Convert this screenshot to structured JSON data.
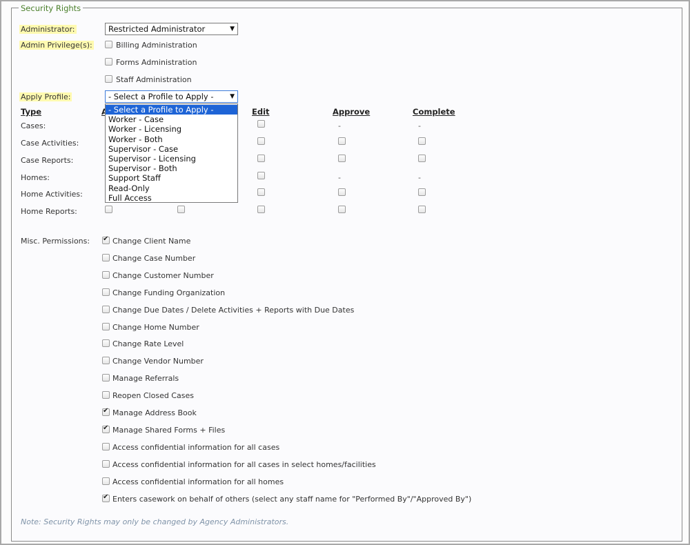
{
  "legend": "Security Rights",
  "administrator": {
    "label": "Administrator:",
    "value": "Restricted Administrator"
  },
  "admin_privileges": {
    "label": "Admin Privilege(s):",
    "items": [
      {
        "label": "Billing Administration",
        "checked": false
      },
      {
        "label": "Forms Administration",
        "checked": false
      },
      {
        "label": "Staff Administration",
        "checked": false
      }
    ]
  },
  "apply_profile": {
    "label": "Apply Profile:",
    "value": "- Select a Profile to Apply -",
    "options": [
      "- Select a Profile to Apply -",
      "Worker - Case",
      "Worker - Licensing",
      "Worker - Both",
      "Supervisor - Case",
      "Supervisor - Licensing",
      "Supervisor - Both",
      "Support Staff",
      "Read-Only",
      "Full Access"
    ],
    "selected_index": 0
  },
  "table": {
    "headers": {
      "type": "Type",
      "add": "A",
      "edit": "Edit",
      "approve": "Approve",
      "complete": "Complete"
    },
    "rows": [
      {
        "label": "Cases:",
        "approve": "-",
        "complete": "-"
      },
      {
        "label": "Case Activities:"
      },
      {
        "label": "Case Reports:"
      },
      {
        "label": "Homes:",
        "approve": "-",
        "complete": "-"
      },
      {
        "label": "Home Activities:"
      },
      {
        "label": "Home Reports:"
      }
    ]
  },
  "misc": {
    "label": "Misc. Permissions:",
    "items": [
      {
        "label": "Change Client Name",
        "checked": true
      },
      {
        "label": "Change Case Number",
        "checked": false
      },
      {
        "label": "Change Customer Number",
        "checked": false
      },
      {
        "label": "Change Funding Organization",
        "checked": false
      },
      {
        "label": "Change Due Dates / Delete Activities + Reports with Due Dates",
        "checked": false
      },
      {
        "label": "Change Home Number",
        "checked": false
      },
      {
        "label": "Change Rate Level",
        "checked": false
      },
      {
        "label": "Change Vendor Number",
        "checked": false
      },
      {
        "label": "Manage Referrals",
        "checked": false
      },
      {
        "label": "Reopen Closed Cases",
        "checked": false
      },
      {
        "label": "Manage Address Book",
        "checked": true
      },
      {
        "label": "Manage Shared Forms + Files",
        "checked": true
      },
      {
        "label": "Access confidential information for all cases",
        "checked": false
      },
      {
        "label": "Access confidential information for all cases in select homes/facilities",
        "checked": false
      },
      {
        "label": "Access confidential information for all homes",
        "checked": false
      },
      {
        "label": "Enters casework on behalf of others (select any staff name for \"Performed By\"/\"Approved By\")",
        "checked": true
      }
    ]
  },
  "note": "Note: Security Rights may only be changed by Agency Administrators.",
  "colors": {
    "legend": "#4a7f2a",
    "highlight": "#fffab0",
    "selection": "#1e64d6",
    "note": "#7f93a8"
  }
}
